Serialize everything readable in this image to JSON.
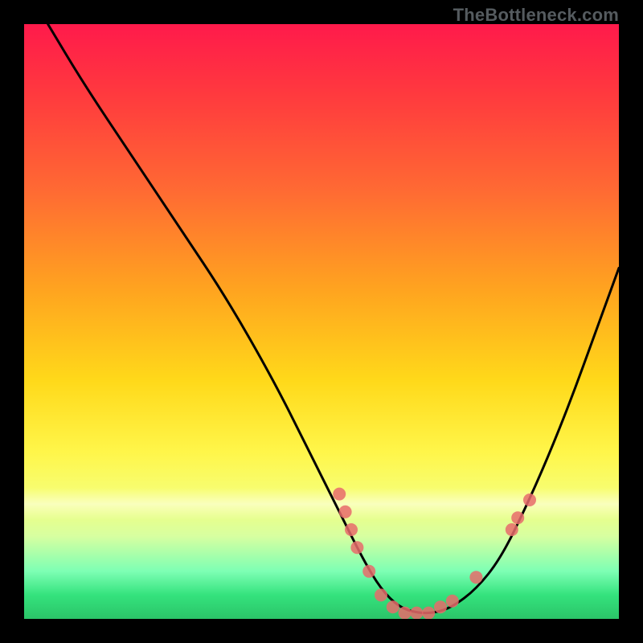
{
  "watermark": "TheBottleneck.com",
  "chart_data": {
    "type": "line",
    "title": "",
    "xlabel": "",
    "ylabel": "",
    "xlim": [
      0,
      100
    ],
    "ylim": [
      0,
      100
    ],
    "grid": false,
    "curve_description": "V-shaped bottleneck curve plotted on a vertical red-to-green gradient; curve descends steeply from upper-left, flattens near the bottom (optimal / green zone), then rises toward the right edge.",
    "series": [
      {
        "name": "bottleneck-curve",
        "color": "#000000",
        "x": [
          4,
          10,
          18,
          26,
          34,
          42,
          48,
          53,
          57,
          60,
          63,
          66,
          69,
          72,
          76,
          80,
          84,
          88,
          92,
          96,
          100
        ],
        "y": [
          100,
          90,
          78,
          66,
          54,
          40,
          28,
          18,
          10,
          5,
          2,
          1,
          1,
          2,
          5,
          10,
          18,
          27,
          37,
          48,
          59
        ]
      }
    ],
    "markers": [
      {
        "name": "cluster-left-upper",
        "x": 53,
        "y": 21,
        "color": "#e76b6b"
      },
      {
        "name": "cluster-left-upper2",
        "x": 54,
        "y": 18,
        "color": "#e76b6b"
      },
      {
        "name": "cluster-left-mid",
        "x": 55,
        "y": 15,
        "color": "#e76b6b"
      },
      {
        "name": "cluster-left-mid2",
        "x": 56,
        "y": 12,
        "color": "#e76b6b"
      },
      {
        "name": "cluster-left-low",
        "x": 58,
        "y": 8,
        "color": "#e76b6b"
      },
      {
        "name": "valley-1",
        "x": 60,
        "y": 4,
        "color": "#e76b6b"
      },
      {
        "name": "valley-2",
        "x": 62,
        "y": 2,
        "color": "#e76b6b"
      },
      {
        "name": "valley-3",
        "x": 64,
        "y": 1,
        "color": "#e76b6b"
      },
      {
        "name": "valley-4",
        "x": 66,
        "y": 1,
        "color": "#e76b6b"
      },
      {
        "name": "valley-5",
        "x": 68,
        "y": 1,
        "color": "#e76b6b"
      },
      {
        "name": "valley-6",
        "x": 70,
        "y": 2,
        "color": "#e76b6b"
      },
      {
        "name": "valley-7",
        "x": 72,
        "y": 3,
        "color": "#e76b6b"
      },
      {
        "name": "cluster-right-low",
        "x": 76,
        "y": 7,
        "color": "#e76b6b"
      },
      {
        "name": "cluster-right-mid",
        "x": 82,
        "y": 15,
        "color": "#e76b6b"
      },
      {
        "name": "cluster-right-mid2",
        "x": 83,
        "y": 17,
        "color": "#e76b6b"
      },
      {
        "name": "cluster-right-upper",
        "x": 85,
        "y": 20,
        "color": "#e76b6b"
      }
    ],
    "gradient_stops": [
      {
        "pos": 0,
        "color": "#ff1a4b"
      },
      {
        "pos": 50,
        "color": "#ffd91a"
      },
      {
        "pos": 100,
        "color": "#2bc468"
      }
    ]
  }
}
